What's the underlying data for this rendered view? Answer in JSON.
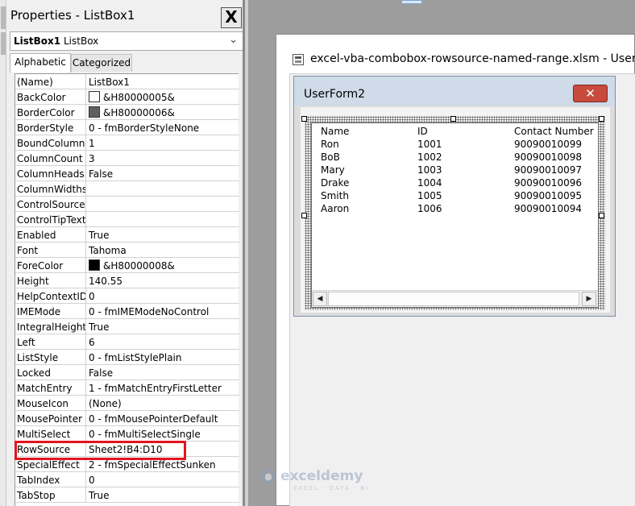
{
  "properties_panel": {
    "title": "Properties - ListBox1",
    "close_label": "X",
    "object": {
      "name": "ListBox1",
      "type": "ListBox"
    },
    "tabs": [
      {
        "label": "Alphabetic",
        "active": true
      },
      {
        "label": "Categorized",
        "active": false
      }
    ],
    "rows": [
      {
        "name": "(Name)",
        "value": "ListBox1"
      },
      {
        "name": "BackColor",
        "value": "&H80000005&",
        "swatch": "#ffffff"
      },
      {
        "name": "BorderColor",
        "value": "&H80000006&",
        "swatch": "#606060"
      },
      {
        "name": "BorderStyle",
        "value": "0 - fmBorderStyleNone"
      },
      {
        "name": "BoundColumn",
        "value": "1"
      },
      {
        "name": "ColumnCount",
        "value": "3"
      },
      {
        "name": "ColumnHeads",
        "value": "False"
      },
      {
        "name": "ColumnWidths",
        "value": ""
      },
      {
        "name": "ControlSource",
        "value": ""
      },
      {
        "name": "ControlTipText",
        "value": ""
      },
      {
        "name": "Enabled",
        "value": "True"
      },
      {
        "name": "Font",
        "value": "Tahoma"
      },
      {
        "name": "ForeColor",
        "value": "&H80000008&",
        "swatch": "#000000"
      },
      {
        "name": "Height",
        "value": "140.55"
      },
      {
        "name": "HelpContextID",
        "value": "0"
      },
      {
        "name": "IMEMode",
        "value": "0 - fmIMEModeNoControl"
      },
      {
        "name": "IntegralHeight",
        "value": "True"
      },
      {
        "name": "Left",
        "value": "6"
      },
      {
        "name": "ListStyle",
        "value": "0 - fmListStylePlain"
      },
      {
        "name": "Locked",
        "value": "False"
      },
      {
        "name": "MatchEntry",
        "value": "1 - fmMatchEntryFirstLetter"
      },
      {
        "name": "MouseIcon",
        "value": "(None)"
      },
      {
        "name": "MousePointer",
        "value": "0 - fmMousePointerDefault"
      },
      {
        "name": "MultiSelect",
        "value": "0 - fmMultiSelectSingle"
      },
      {
        "name": "RowSource",
        "value": "Sheet2!B4:D10",
        "highlighted": true
      },
      {
        "name": "SpecialEffect",
        "value": "2 - fmSpecialEffectSunken"
      },
      {
        "name": "TabIndex",
        "value": "0"
      },
      {
        "name": "TabStop",
        "value": "True"
      }
    ]
  },
  "designer": {
    "title": "excel-vba-combobox-rowsource-named-range.xlsm - UserFo"
  },
  "userform": {
    "title": "UserForm2",
    "close_label": "✕",
    "listbox": {
      "headers": [
        "Name",
        "ID",
        "Contact Number"
      ],
      "rows": [
        [
          "Ron",
          "1001",
          "90090010099"
        ],
        [
          "BoB",
          "1002",
          "90090010098"
        ],
        [
          "Mary",
          "1003",
          "90090010097"
        ],
        [
          "Drake",
          "1004",
          "90090010096"
        ],
        [
          "Smith",
          "1005",
          "90090010095"
        ],
        [
          "Aaron",
          "1006",
          "90090010094"
        ]
      ]
    }
  },
  "watermark": {
    "brand": "exceldemy",
    "tagline": "EXCEL · DATA · BI"
  },
  "colors": {
    "highlight": "#e3141f",
    "userform_close": "#c74a3d",
    "workspace": "#9d9d9d"
  }
}
